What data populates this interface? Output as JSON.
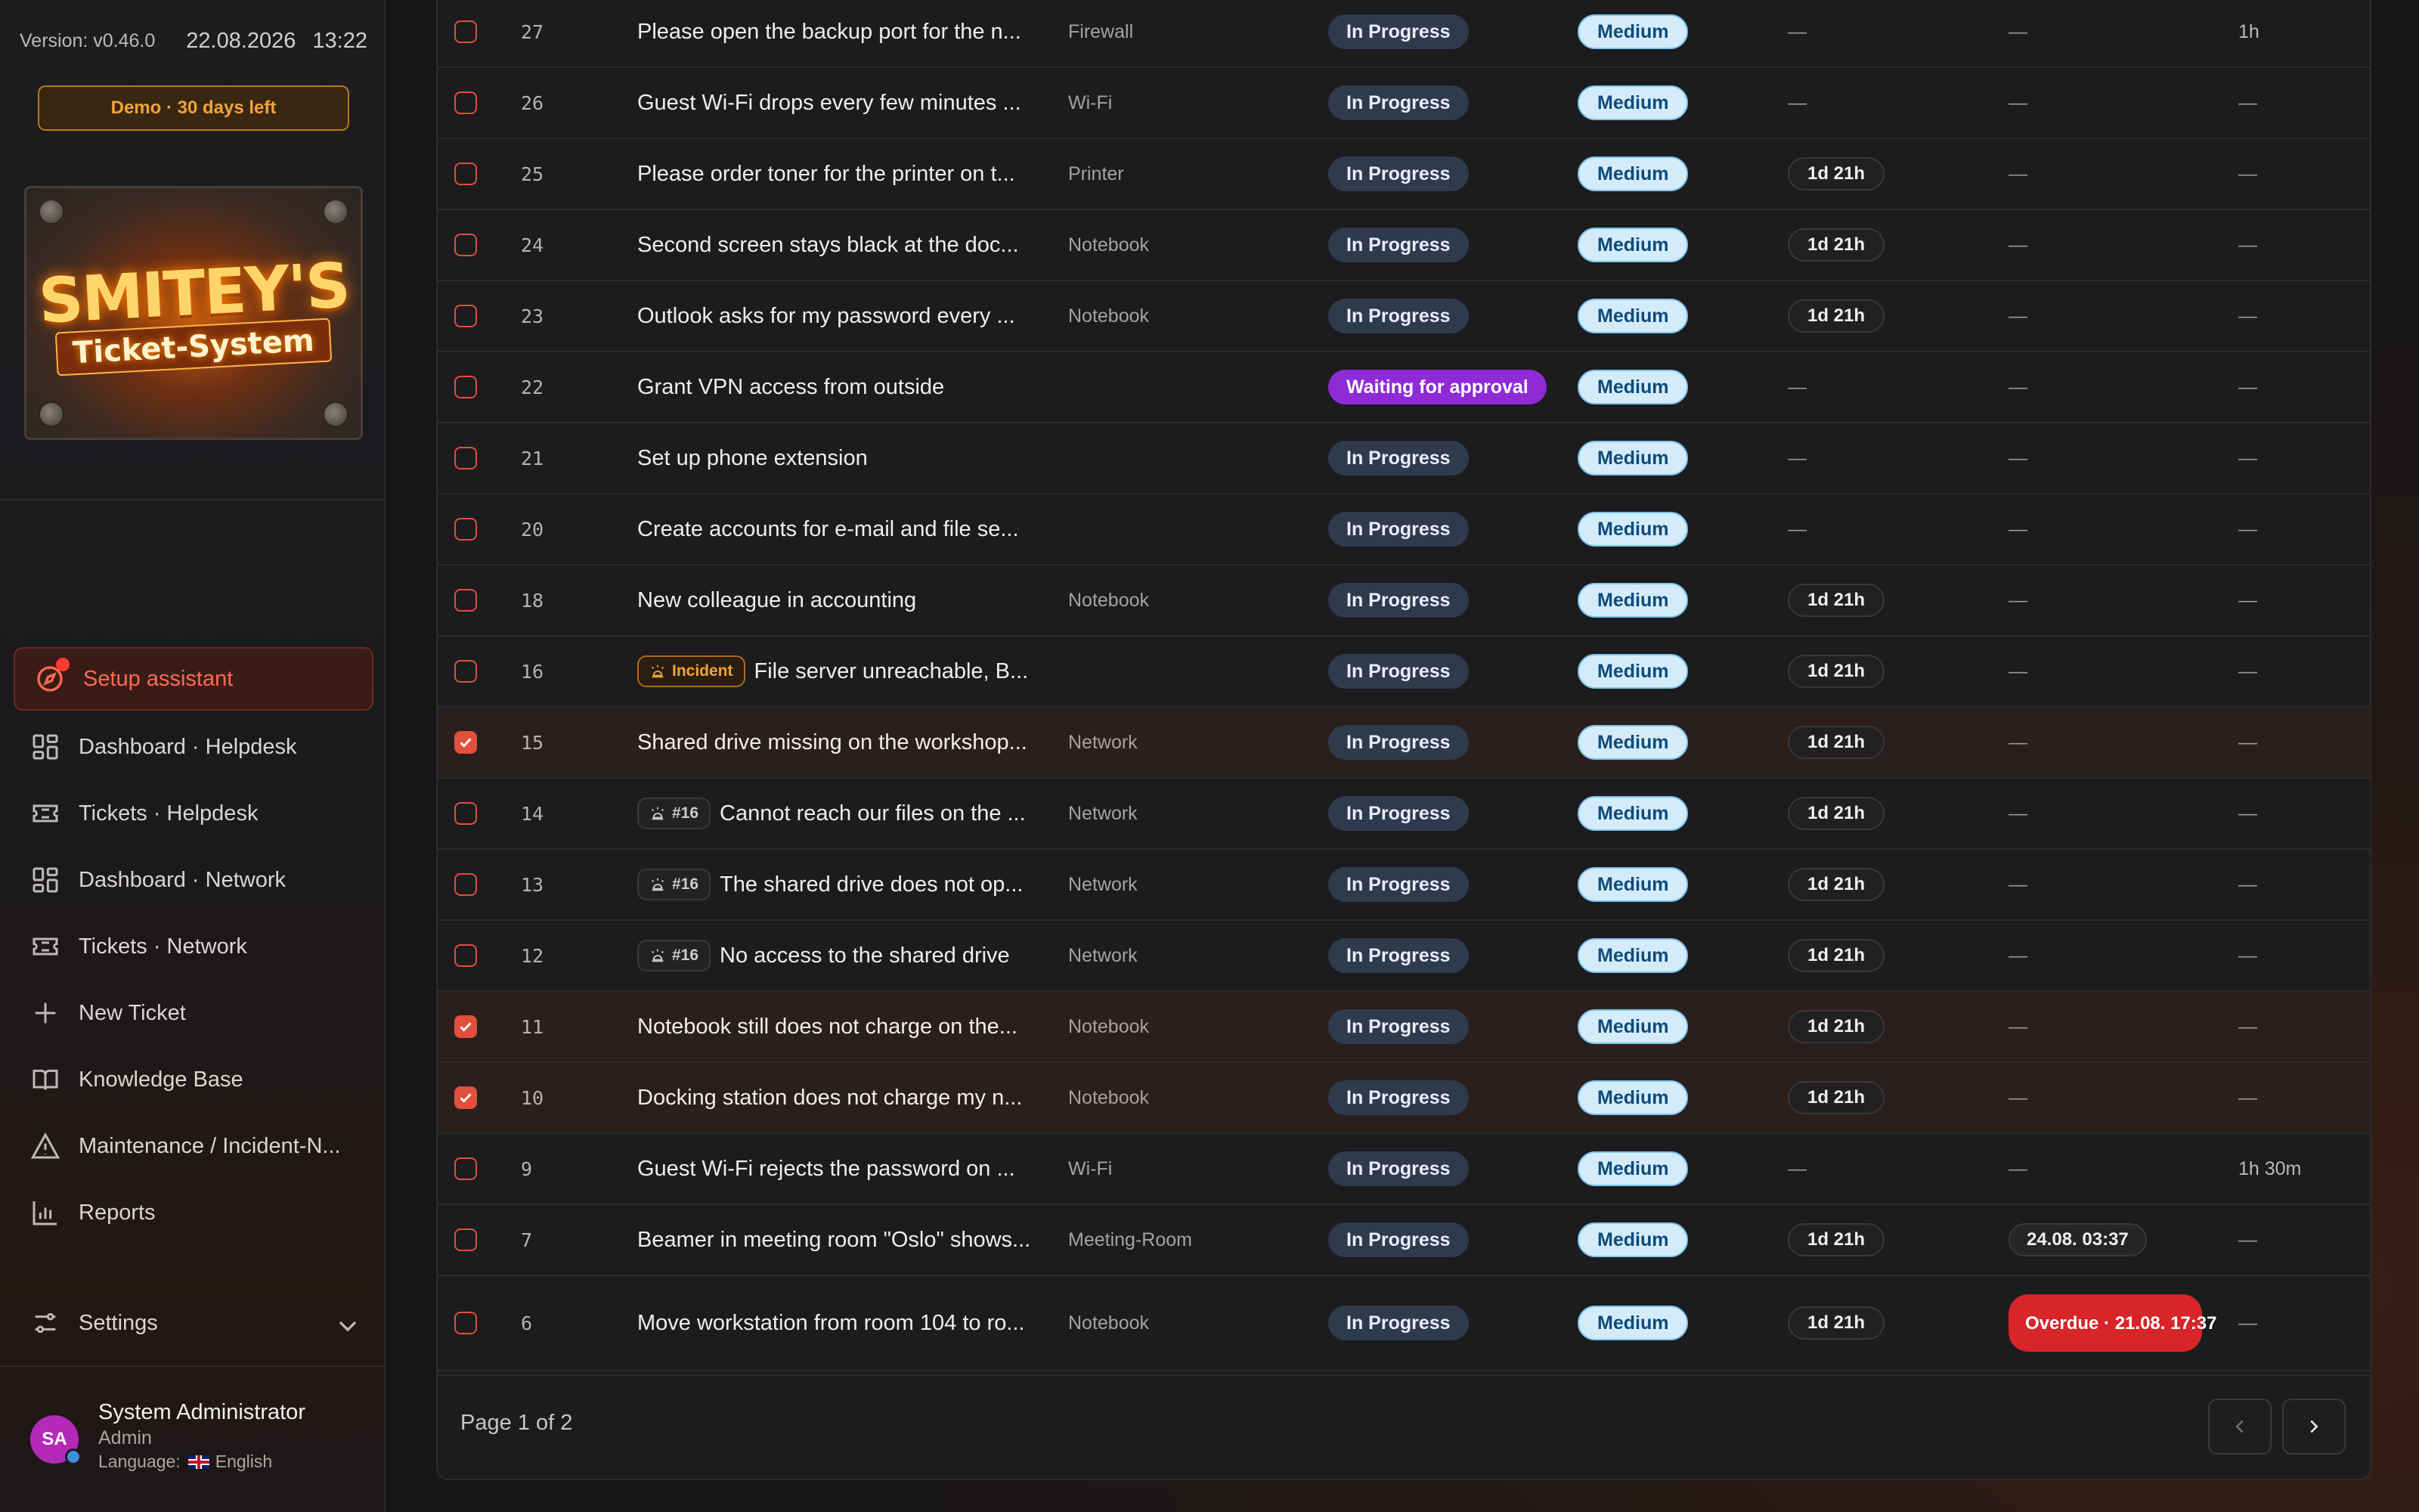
{
  "sidebar": {
    "version": "Version: v0.46.0",
    "date": "22.08.2026",
    "time": "13:22",
    "demo": "Demo · 30 days left",
    "logo_line1": "SMITEY'S",
    "logo_line2": "Ticket-System",
    "setup": "Setup assistant",
    "nav": [
      {
        "label": "Dashboard · Helpdesk",
        "icon": "dashboard-grid-icon"
      },
      {
        "label": "Tickets · Helpdesk",
        "icon": "ticket-icon"
      },
      {
        "label": "Dashboard · Network",
        "icon": "dashboard-grid-icon"
      },
      {
        "label": "Tickets · Network",
        "icon": "ticket-icon"
      },
      {
        "label": "New Ticket",
        "icon": "plus-icon"
      },
      {
        "label": "Knowledge Base",
        "icon": "book-icon"
      },
      {
        "label": "Maintenance / Incident-N...",
        "icon": "warning-triangle-icon"
      },
      {
        "label": "Reports",
        "icon": "bar-chart-icon"
      }
    ],
    "settings": "Settings",
    "user": {
      "initials": "SA",
      "name": "System Administrator",
      "role": "Admin",
      "language_label": "Language:",
      "language": "English"
    }
  },
  "tickets": [
    {
      "id": "27",
      "title": "Please open the backup port for the n...",
      "category": "Firewall",
      "status": "In Progress",
      "priority": "Medium",
      "time": "",
      "due": "",
      "due_overdue": false,
      "work": "1h",
      "checked": false,
      "tag": ""
    },
    {
      "id": "26",
      "title": "Guest Wi-Fi drops every few minutes ...",
      "category": "Wi-Fi",
      "status": "In Progress",
      "priority": "Medium",
      "time": "",
      "due": "",
      "due_overdue": false,
      "work": "",
      "checked": false,
      "tag": ""
    },
    {
      "id": "25",
      "title": "Please order toner for the printer on t...",
      "category": "Printer",
      "status": "In Progress",
      "priority": "Medium",
      "time": "1d 21h",
      "due": "",
      "due_overdue": false,
      "work": "",
      "checked": false,
      "tag": ""
    },
    {
      "id": "24",
      "title": "Second screen stays black at the doc...",
      "category": "Notebook",
      "status": "In Progress",
      "priority": "Medium",
      "time": "1d 21h",
      "due": "",
      "due_overdue": false,
      "work": "",
      "checked": false,
      "tag": ""
    },
    {
      "id": "23",
      "title": "Outlook asks for my password every ...",
      "category": "Notebook",
      "status": "In Progress",
      "priority": "Medium",
      "time": "1d 21h",
      "due": "",
      "due_overdue": false,
      "work": "",
      "checked": false,
      "tag": ""
    },
    {
      "id": "22",
      "title": "Grant VPN access from outside",
      "category": "",
      "status": "Waiting for approval",
      "priority": "Medium",
      "time": "",
      "due": "",
      "due_overdue": false,
      "work": "",
      "checked": false,
      "tag": ""
    },
    {
      "id": "21",
      "title": "Set up phone extension",
      "category": "",
      "status": "In Progress",
      "priority": "Medium",
      "time": "",
      "due": "",
      "due_overdue": false,
      "work": "",
      "checked": false,
      "tag": ""
    },
    {
      "id": "20",
      "title": "Create accounts for e-mail and file se...",
      "category": "",
      "status": "In Progress",
      "priority": "Medium",
      "time": "",
      "due": "",
      "due_overdue": false,
      "work": "",
      "checked": false,
      "tag": ""
    },
    {
      "id": "18",
      "title": "New colleague in accounting",
      "category": "Notebook",
      "status": "In Progress",
      "priority": "Medium",
      "time": "1d 21h",
      "due": "",
      "due_overdue": false,
      "work": "",
      "checked": false,
      "tag": ""
    },
    {
      "id": "16",
      "title": "File server unreachable, B...",
      "category": "",
      "status": "In Progress",
      "priority": "Medium",
      "time": "1d 21h",
      "due": "",
      "due_overdue": false,
      "work": "",
      "checked": false,
      "tag": "incident",
      "tag_label": "Incident"
    },
    {
      "id": "15",
      "title": "Shared drive missing on the workshop...",
      "category": "Network",
      "status": "In Progress",
      "priority": "Medium",
      "time": "1d 21h",
      "due": "",
      "due_overdue": false,
      "work": "",
      "checked": true,
      "tag": ""
    },
    {
      "id": "14",
      "title": "Cannot reach our files on the ...",
      "category": "Network",
      "status": "In Progress",
      "priority": "Medium",
      "time": "1d 21h",
      "due": "",
      "due_overdue": false,
      "work": "",
      "checked": false,
      "tag": "ref",
      "tag_label": "#16"
    },
    {
      "id": "13",
      "title": "The shared drive does not op...",
      "category": "Network",
      "status": "In Progress",
      "priority": "Medium",
      "time": "1d 21h",
      "due": "",
      "due_overdue": false,
      "work": "",
      "checked": false,
      "tag": "ref",
      "tag_label": "#16"
    },
    {
      "id": "12",
      "title": "No access to the shared drive",
      "category": "Network",
      "status": "In Progress",
      "priority": "Medium",
      "time": "1d 21h",
      "due": "",
      "due_overdue": false,
      "work": "",
      "checked": false,
      "tag": "ref",
      "tag_label": "#16"
    },
    {
      "id": "11",
      "title": "Notebook still does not charge on the...",
      "category": "Notebook",
      "status": "In Progress",
      "priority": "Medium",
      "time": "1d 21h",
      "due": "",
      "due_overdue": false,
      "work": "",
      "checked": true,
      "tag": ""
    },
    {
      "id": "10",
      "title": "Docking station does not charge my n...",
      "category": "Notebook",
      "status": "In Progress",
      "priority": "Medium",
      "time": "1d 21h",
      "due": "",
      "due_overdue": false,
      "work": "",
      "checked": true,
      "tag": ""
    },
    {
      "id": "9",
      "title": "Guest Wi-Fi rejects the password on ...",
      "category": "Wi-Fi",
      "status": "In Progress",
      "priority": "Medium",
      "time": "",
      "due": "",
      "due_overdue": false,
      "work": "1h 30m",
      "checked": false,
      "tag": ""
    },
    {
      "id": "7",
      "title": "Beamer in meeting room \"Oslo\" shows...",
      "category": "Meeting-Room",
      "status": "In Progress",
      "priority": "Medium",
      "time": "1d 21h",
      "due": "24.08. 03:37",
      "due_overdue": false,
      "work": "",
      "checked": false,
      "tag": ""
    },
    {
      "id": "6",
      "title": "Move workstation from room 104 to ro...",
      "category": "Notebook",
      "status": "In Progress",
      "priority": "Medium",
      "time": "1d 21h",
      "due": "Overdue · 21.08. 17:37",
      "due_overdue": true,
      "work": "",
      "checked": false,
      "tag": ""
    }
  ],
  "empty_value": "—",
  "pagination": {
    "label": "Page 1 of 2",
    "prev_icon": "chevron-left-icon",
    "next_icon": "chevron-right-icon"
  },
  "colors": {
    "accent": "#e0503c",
    "status_progress": "#2f3a4d",
    "status_waiting": "#8e2bd6",
    "priority_medium": "#d4ecfa",
    "overdue": "#d7252a",
    "demo": "#f0a43a"
  }
}
